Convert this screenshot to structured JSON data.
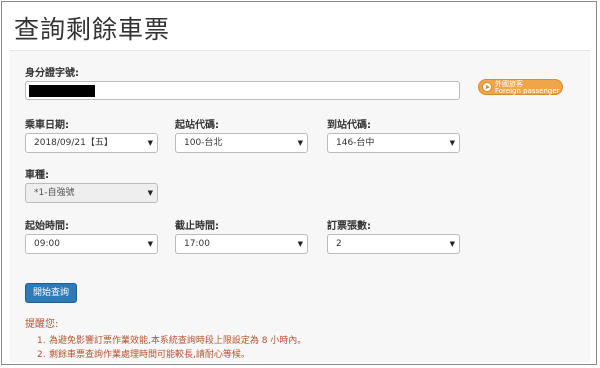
{
  "page": {
    "title": "查詢剩餘車票"
  },
  "form": {
    "id_label": "身分證字號:",
    "foreign_button": {
      "line1": "外國旅客",
      "line2": "Foreign passenger"
    },
    "date": {
      "label": "乘車日期:",
      "value": "2018/09/21【五】"
    },
    "from_station": {
      "label": "起站代碼:",
      "value": "100-台北"
    },
    "to_station": {
      "label": "到站代碼:",
      "value": "146-台中"
    },
    "train_type": {
      "label": "車種:",
      "value": "*1-自強號"
    },
    "start_time": {
      "label": "起始時間:",
      "value": "09:00"
    },
    "end_time": {
      "label": "截止時間:",
      "value": "17:00"
    },
    "ticket_count": {
      "label": "訂票張數:",
      "value": "2"
    },
    "submit_label": "開始查詢"
  },
  "reminder": {
    "title": "提醒您:",
    "items": [
      {
        "num": "1.",
        "text": "為避免影響訂票作業效能,本系統查詢時段上限設定為 8 小時內。"
      },
      {
        "num": "2.",
        "text": "剩餘車票查詢作業處理時間可能較長,請耐心等候。"
      }
    ]
  },
  "icons": {
    "caret": "caret-down-icon",
    "play": "play-circle-icon"
  },
  "colors": {
    "primary_button": "#2f7bb8",
    "foreign_button": "#f0a54a",
    "reminder_text": "#b5532f"
  }
}
